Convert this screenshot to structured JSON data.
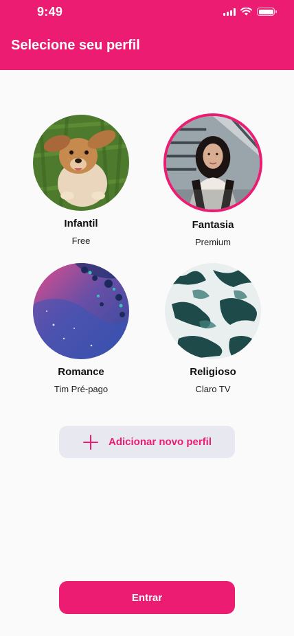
{
  "status_bar": {
    "time": "9:49"
  },
  "header": {
    "title": "Selecione seu perfil"
  },
  "colors": {
    "accent": "#ec1c73",
    "secondary_button": "#e8e8f0"
  },
  "profiles": [
    {
      "name": "Infantil",
      "plan": "Free",
      "selected": false,
      "image": "dog-photo"
    },
    {
      "name": "Fantasia",
      "plan": "Premium",
      "selected": true,
      "image": "woman-photo"
    },
    {
      "name": "Romance",
      "plan": "Tim Pré-pago",
      "selected": false,
      "image": "abstract-bubbles-photo"
    },
    {
      "name": "Religioso",
      "plan": "Claro TV",
      "selected": false,
      "image": "ocean-waves-photo"
    }
  ],
  "actions": {
    "add_profile_label": "Adicionar novo perfil",
    "enter_label": "Entrar"
  }
}
